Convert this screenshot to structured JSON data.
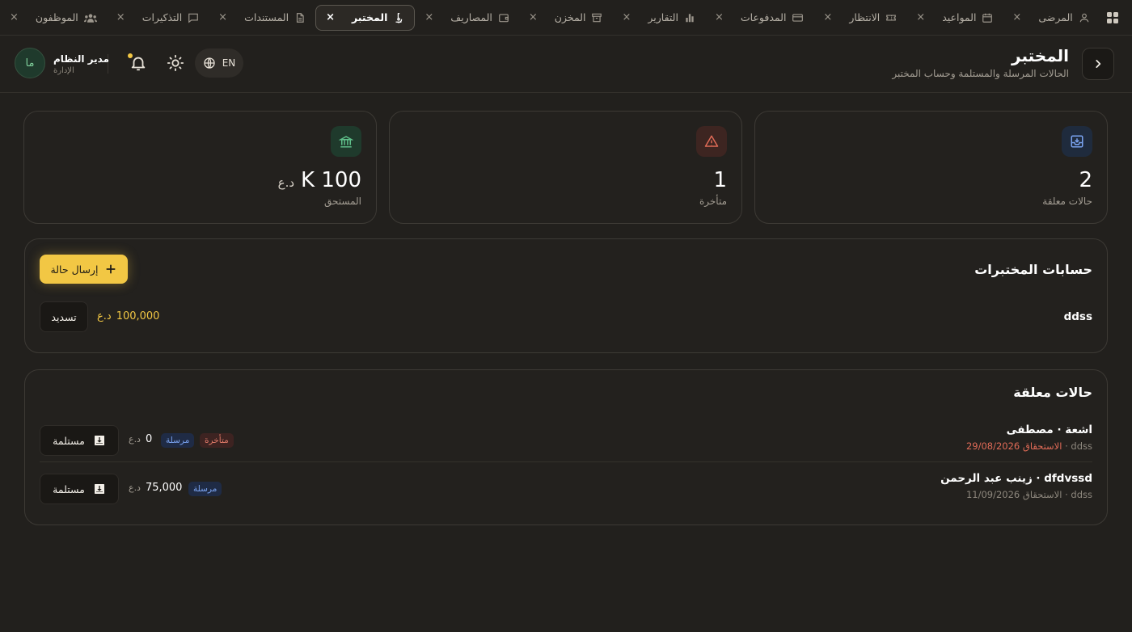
{
  "tabs": [
    {
      "label": "المرضى",
      "icon": "user-icon",
      "active": false
    },
    {
      "label": "المواعيد",
      "icon": "calendar-icon",
      "active": false
    },
    {
      "label": "الانتظار",
      "icon": "ticket-icon",
      "active": false
    },
    {
      "label": "المدفوعات",
      "icon": "credit-card-icon",
      "active": false
    },
    {
      "label": "التقارير",
      "icon": "bar-chart-icon",
      "active": false
    },
    {
      "label": "المخزن",
      "icon": "archive-icon",
      "active": false
    },
    {
      "label": "المصاريف",
      "icon": "wallet-icon",
      "active": false
    },
    {
      "label": "المختبر",
      "icon": "microscope-icon",
      "active": true
    },
    {
      "label": "المستندات",
      "icon": "document-icon",
      "active": false
    },
    {
      "label": "التذكيرات",
      "icon": "message-icon",
      "active": false
    },
    {
      "label": "الموظفون",
      "icon": "users-icon",
      "active": false
    }
  ],
  "tab_close_symbol": "×",
  "header": {
    "title": "المختبر",
    "subtitle": "الحالات المرسلة والمستلمة وحساب المختبر",
    "language": "EN",
    "user": {
      "initials": "ما",
      "name": "مدير النظام",
      "role": "الإدارة"
    }
  },
  "stats": [
    {
      "value": "2",
      "label": "حالات معلقة",
      "icon": "inbox-icon",
      "color": "#7aa3f0",
      "bg": "#1f2b3d"
    },
    {
      "value": "1",
      "label": "متأخرة",
      "icon": "warning-icon",
      "color": "#e06b57",
      "bg": "#3d2521"
    },
    {
      "value": "100 K",
      "currency": "د.ع",
      "label": "المستحق",
      "icon": "bank-icon",
      "color": "#5fbf8a",
      "bg": "#1f3a2c"
    }
  ],
  "labs_section": {
    "title": "حسابات المختبرات",
    "send_button": "إرسال حالة",
    "lab": {
      "name": "ddss",
      "amount": "100,000",
      "currency": "د.ع",
      "pay_button": "تسديد"
    }
  },
  "pending_section": {
    "title": "حالات معلقة",
    "cases": [
      {
        "title": "اشعة · مصطفى",
        "lab": "ddss",
        "due_label": "الاستحقاق",
        "due_date": "29/08/2026",
        "late": true,
        "badges": [
          "مرسلة",
          "متأخرة"
        ],
        "amount": "0",
        "currency": "د.ع",
        "action": "مستلمة"
      },
      {
        "title": "dfdvssd · زينب عبد الرحمن",
        "lab": "ddss",
        "due_label": "الاستحقاق",
        "due_date": "11/09/2026",
        "late": false,
        "badges": [
          "مرسلة"
        ],
        "amount": "75,000",
        "currency": "د.ع",
        "action": "مستلمة"
      }
    ]
  },
  "colors": {
    "accent": "#f2c744",
    "background": "#22201d",
    "card": "#23211e",
    "late": "#e06b57",
    "sent": "#7aa3f0"
  }
}
